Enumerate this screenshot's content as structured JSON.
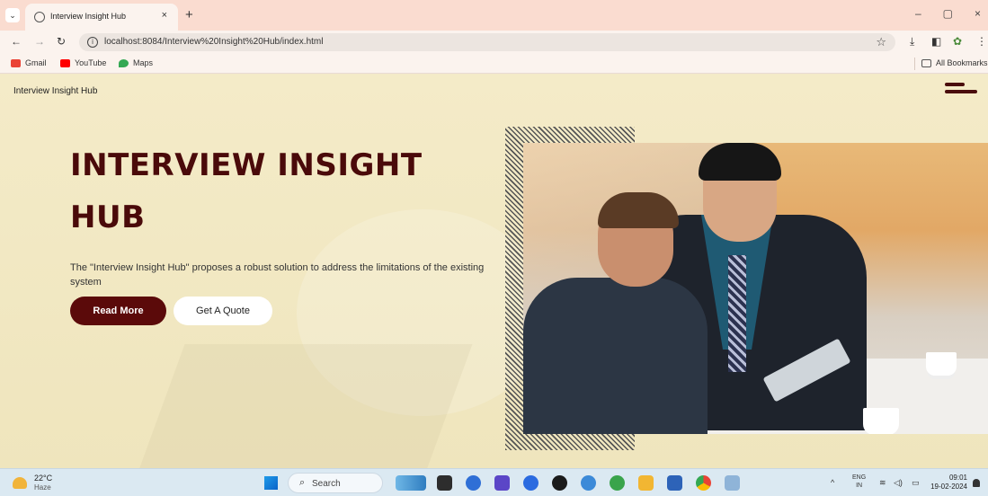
{
  "browser": {
    "tab_title": "Interview Insight Hub",
    "tab_close": "×",
    "new_tab": "+",
    "url": "localhost:8084/Interview%20Insight%20Hub/index.html",
    "window_controls": [
      "–",
      "▢",
      "×"
    ],
    "bookmarks": [
      {
        "label": "Gmail",
        "icon": "gmail-icon",
        "color": "#ea4335"
      },
      {
        "label": "YouTube",
        "icon": "youtube-icon",
        "color": "#ff0000"
      },
      {
        "label": "Maps",
        "icon": "maps-icon",
        "color": "#34a853"
      }
    ],
    "all_bookmarks": "All Bookmarks"
  },
  "page": {
    "brand": "Interview Insight Hub",
    "hero_title": "INTERVIEW INSIGHT HUB",
    "hero_description": "The \"Interview Insight Hub\" proposes a robust solution to address the limitations of the existing system",
    "primary_button": "Read More",
    "secondary_button": "Get A Quote",
    "accent_color": "#5b0a0a",
    "background_color": "#f3e9c9"
  },
  "taskbar": {
    "weather_temp": "22°C",
    "weather_desc": "Haze",
    "search_label": "Search",
    "lang_line1": "ENG",
    "lang_line2": "IN",
    "time": "09:01",
    "date": "19-02-2024"
  }
}
